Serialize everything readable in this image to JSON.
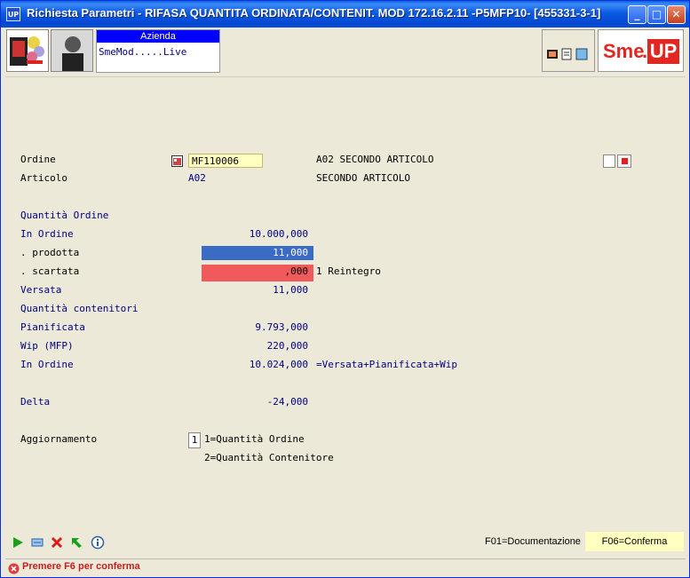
{
  "window": {
    "app_icon": "UP",
    "title": "Richiesta Parametri -  RIFASA QUANTITA ORDINATA/CONTENIT. MOD 172.16.2.11 -P5MFP10- [455331-3-1]"
  },
  "azienda": {
    "header": "Azienda",
    "value": "SmeMod.....Live"
  },
  "logo": {
    "part1": "Sme",
    "dot": ".",
    "part2": "UP"
  },
  "form": {
    "ordine_label": "Ordine",
    "ordine_value": "MF110006",
    "ordine_desc": "A02 SECONDO ARTICOLO",
    "articolo_label": "Articolo",
    "articolo_value": "A02",
    "articolo_desc": "SECONDO ARTICOLO",
    "quantita_ordine_label": "Quantità Ordine",
    "in_ordine_label": "In Ordine",
    "in_ordine_value": "10.000,000",
    "prodotta_label": ". prodotta",
    "prodotta_value": "11,000",
    "scartata_label": ". scartata",
    "scartata_value": ",000",
    "reintegro_text": "1 Reintegro",
    "versata_label": "Versata",
    "versata_value": "11,000",
    "quantita_contenitori_label": "Quantità contenitori",
    "pianificata_label": "Pianificata",
    "pianificata_value": "9.793,000",
    "wip_label": "Wip (MFP)",
    "wip_value": "220,000",
    "in_ordine2_label": "In Ordine",
    "in_ordine2_value": "10.024,000",
    "formula_text": "=Versata+Pianificata+Wip",
    "delta_label": "Delta",
    "delta_value": "-24,000",
    "aggiornamento_label": "Aggiornamento",
    "aggiornamento_value": "1",
    "option1": "1=Quantità Ordine",
    "option2": "2=Quantità Contenitore"
  },
  "footer": {
    "f01": "F01=Documentazione",
    "f06": "F06=Conferma"
  },
  "status": {
    "message": "Premere F6 per conferma"
  },
  "colors": {
    "blue_bar": "#3a6cc6",
    "red_bar": "#f05a5a",
    "yellow_field": "#ffffc0",
    "text_navy": "#000080"
  }
}
